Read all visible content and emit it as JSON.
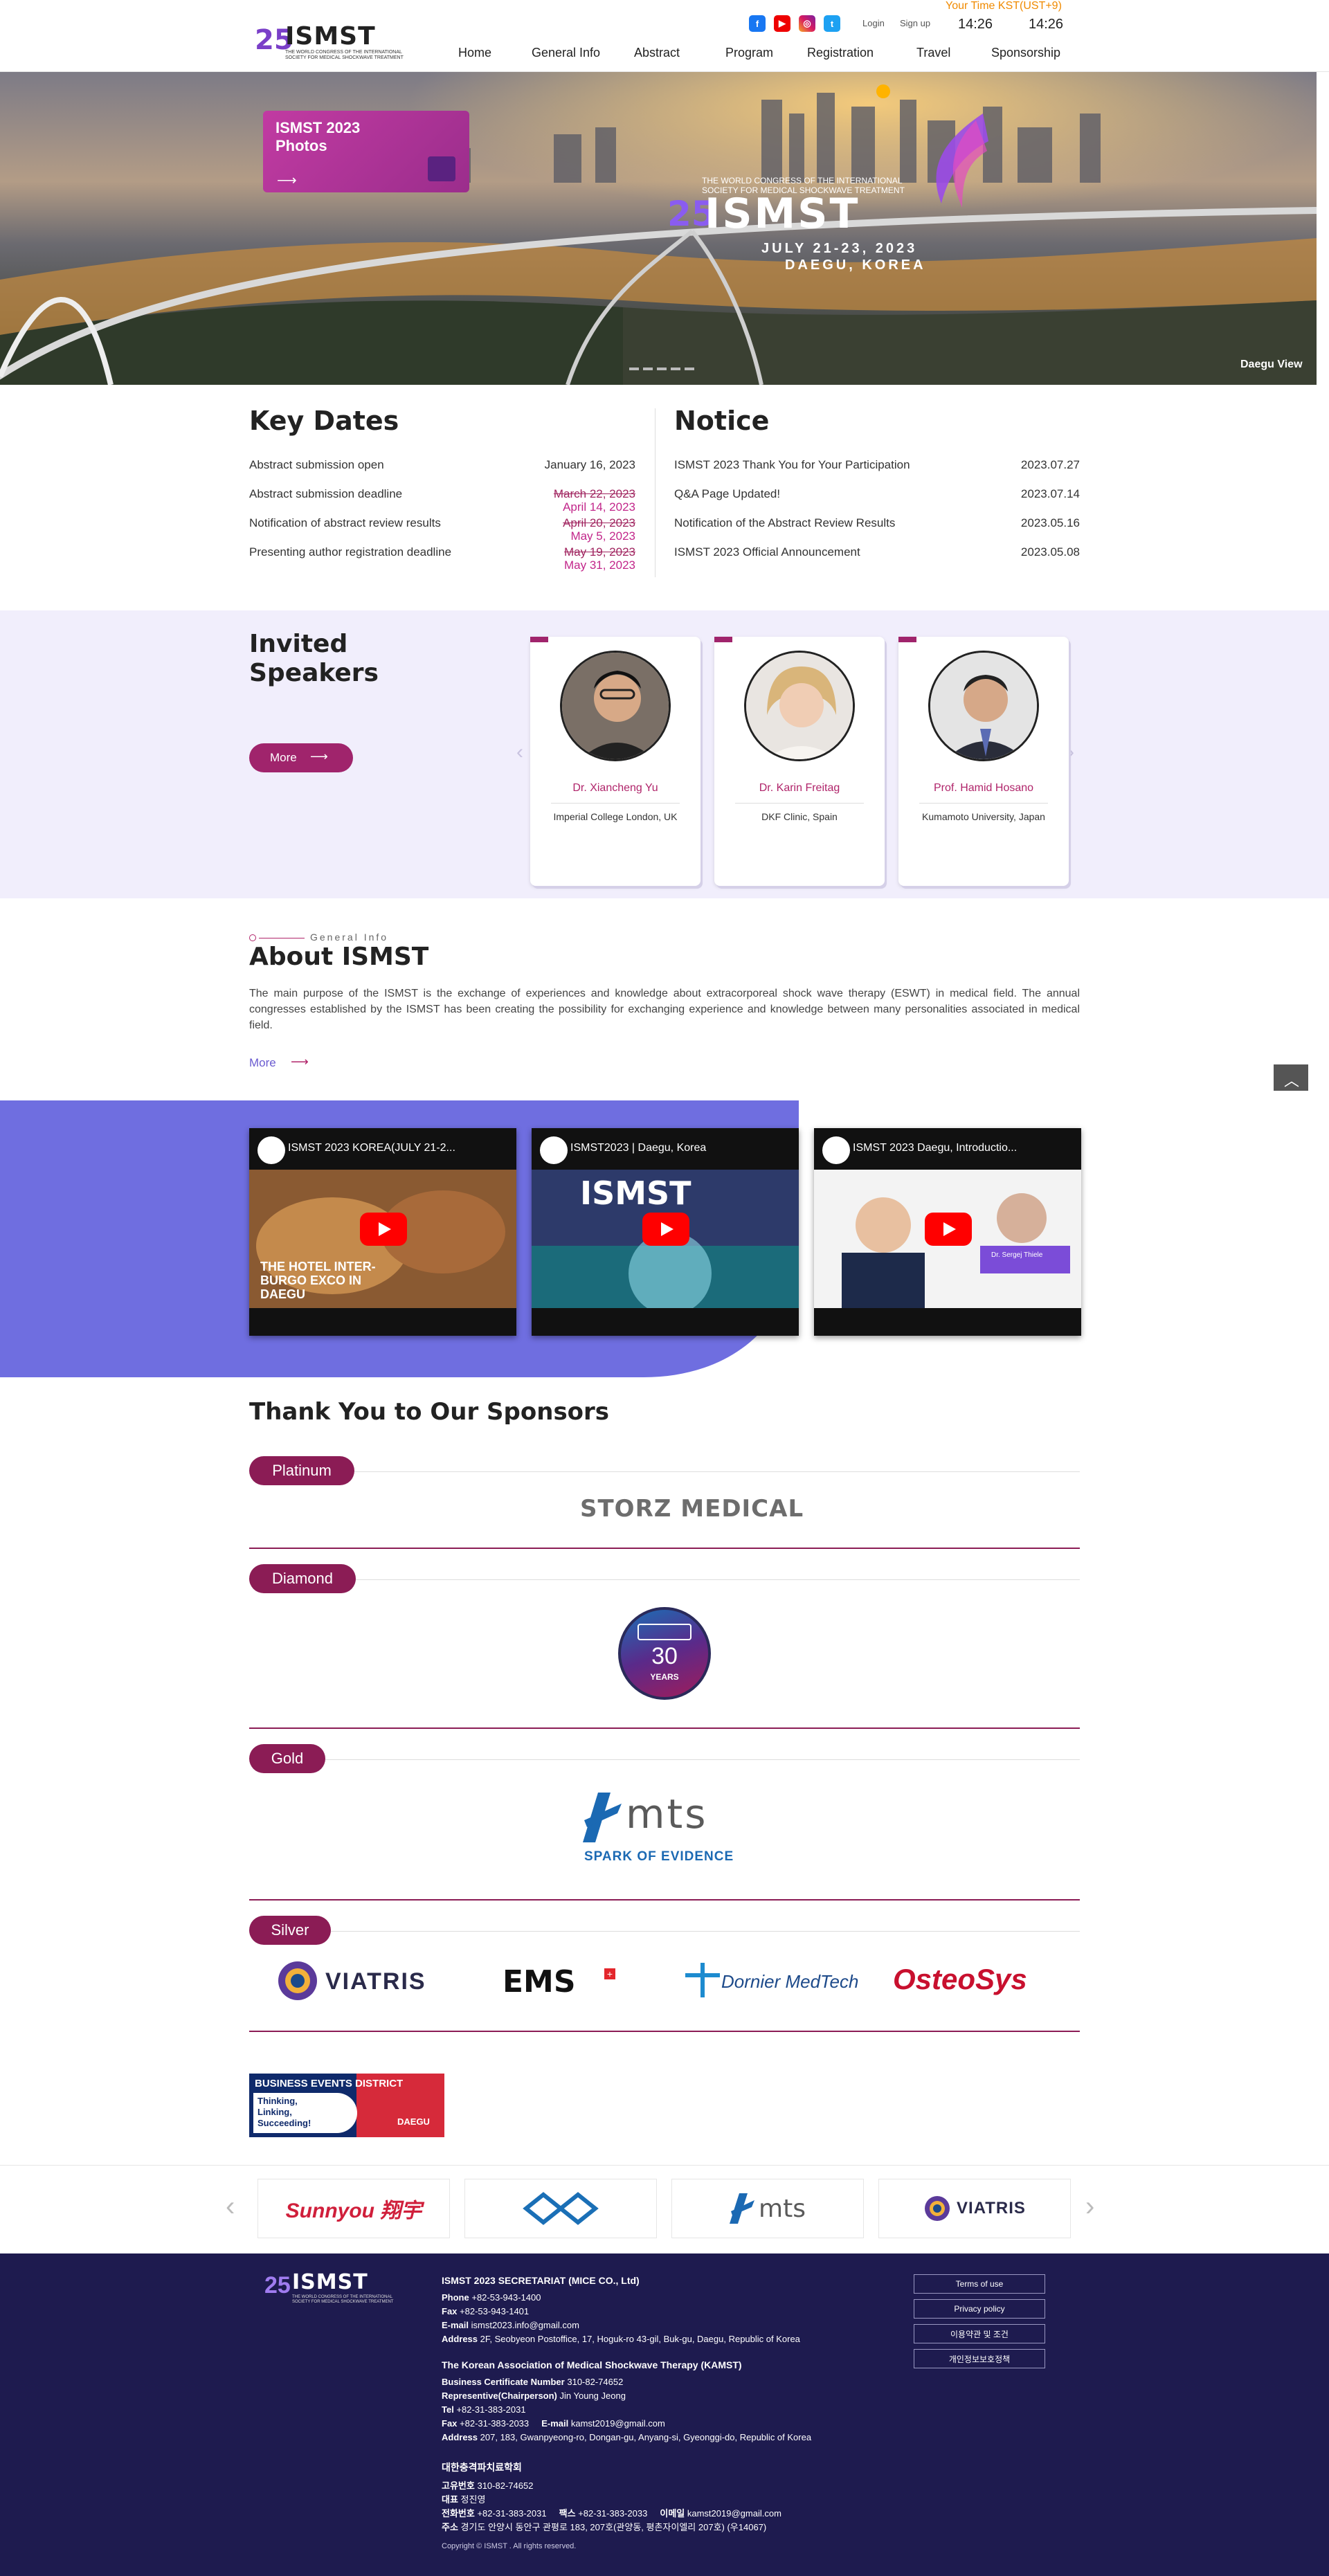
{
  "header": {
    "logo": {
      "word": "ISMST",
      "number": "25",
      "line1": "THE WORLD CONGRESS OF THE INTERNATIONAL",
      "line2": "SOCIETY FOR MEDICAL SHOCKWAVE TREATMENT"
    },
    "time_label": "Your Time  KST(UST+9)",
    "time1": "14:26",
    "time2": "14:26",
    "login": "Login",
    "signup": "Sign up",
    "nav": [
      "Home",
      "General Info",
      "Abstract",
      "Program",
      "Registration",
      "Travel",
      "Sponsorship"
    ]
  },
  "hero": {
    "photo_card": "ISMST 2023 Photos",
    "brand_line1": "THE WORLD CONGRESS OF THE INTERNATIONAL",
    "brand_line2": "SOCIETY FOR MEDICAL SHOCKWAVE TREATMENT",
    "brand_word": "ISMST",
    "brand_num": "25",
    "dates": "JULY 21-23, 2023",
    "city": "DAEGU, KOREA",
    "caption": "Daegu View"
  },
  "key_dates": {
    "title": "Key Dates",
    "rows": [
      {
        "label": "Abstract submission open",
        "date": "January 16, 2023",
        "old": "",
        "new": ""
      },
      {
        "label": "Abstract submission deadline",
        "date": "",
        "old": "March 22, 2023",
        "new": "April 14, 2023"
      },
      {
        "label": "Notification of abstract review results",
        "date": "",
        "old": "April 20, 2023",
        "new": "May 5, 2023"
      },
      {
        "label": "Presenting author registration deadline",
        "date": "",
        "old": "May 19, 2023",
        "new": "May 31, 2023"
      }
    ]
  },
  "notice": {
    "title": "Notice",
    "rows": [
      {
        "label": "ISMST 2023 Thank You for Your Participation",
        "date": "2023.07.27"
      },
      {
        "label": "Q&A Page Updated!",
        "date": "2023.07.14"
      },
      {
        "label": "Notification of the Abstract Review Results",
        "date": "2023.05.16"
      },
      {
        "label": "ISMST 2023 Official Announcement",
        "date": "2023.05.08"
      }
    ]
  },
  "speakers": {
    "title1": "Invited",
    "title2": "Speakers",
    "more": "More",
    "cards": [
      {
        "name": "Dr. Xiancheng Yu",
        "aff": "Imperial College London, UK"
      },
      {
        "name": "Dr. Karin Freitag",
        "aff": "DKF Clinic, Spain"
      },
      {
        "name": "Prof. Hamid Hosano",
        "aff": "Kumamoto University, Japan"
      }
    ]
  },
  "about": {
    "eyebrow": "General Info",
    "title": "About ISMST",
    "text": "The main purpose of the ISMST is the exchange of experiences and knowledge about extracorporeal shock wave therapy (ESWT) in medical field. The annual congresses established by the ISMST has been creating the possibility for exchanging experience and knowledge between many personalities associated in medical field.",
    "more": "More"
  },
  "videos": [
    {
      "title": "ISMST 2023 KOREA(JULY 21-2...",
      "overlay": "THE HOTEL INTER-BURGO EXCO IN DAEGU"
    },
    {
      "title": "ISMST2023 | Daegu, Korea",
      "overlay": ""
    },
    {
      "title": "ISMST 2023 Daegu, Introductio...",
      "overlay": "Dr. Sergej Thiele"
    }
  ],
  "sponsors": {
    "title": "Thank You to Our Sponsors",
    "tiers": {
      "platinum": "Platinum",
      "diamond": "Diamond",
      "gold": "Gold",
      "silver": "Silver"
    },
    "storz": "STORZ MEDICAL",
    "diamond_years": "30",
    "diamond_word": "YEARS",
    "mts_word": "mts",
    "mts_tag": "SPARK OF EVIDENCE",
    "silver": [
      "VIATRIS",
      "EMS",
      "Dornier MedTech",
      "OsteoSys"
    ],
    "bed": {
      "l1": "BUSINESS EVENTS DISTRICT",
      "l2": "Thinking,",
      "l3": "Linking,",
      "l4": "Succeeding!",
      "l5": "DAEGU"
    }
  },
  "slider": {
    "logos": [
      "Sunnyou 翔宇",
      "",
      "mts",
      "VIATRIS"
    ]
  },
  "footer": {
    "sec_title": "ISMST 2023 SECRETARIAT (MICE CO., Ltd)",
    "phone_l": "Phone",
    "phone": "+82-53-943-1400",
    "fax_l": "Fax",
    "fax": "+82-53-943-1401",
    "email_l": "E-mail",
    "email": "ismst2023.info@gmail.com",
    "addr_l": "Address",
    "addr": "2F, Seobyeon Postoffice, 17, Hoguk-ro 43-gil, Buk-gu, Daegu, Republic of Korea",
    "kamst_title": "The Korean Association of Medical Shockwave Therapy (KAMST)",
    "bcn_l": "Business Certificate Number",
    "bcn": "310-82-74652",
    "rep_l": "Representive(Chairperson)",
    "rep": "Jin Young Jeong",
    "tel_l": "Tel",
    "tel": "+82-31-383-2031",
    "kfax_l": "Fax",
    "kfax": "+82-31-383-2033",
    "kmail_l": "E-mail",
    "kmail": "kamst2019@gmail.com",
    "kaddr_l": "Address",
    "kaddr": "207, 183, Gwanpyeong-ro, Dongan-gu, Anyang-si, Gyeonggi-do, Republic of Korea",
    "kr_title": "대한충격파치료학회",
    "kr1_l": "고유번호",
    "kr1": "310-82-74652",
    "kr2_l": "대표",
    "kr2": "정진영",
    "kr3_l": "전화번호",
    "kr3": "+82-31-383-2031",
    "kr3b_l": "팩스",
    "kr3b": "+82-31-383-2033",
    "kr3c_l": "이메일",
    "kr3c": "kamst2019@gmail.com",
    "kr4_l": "주소",
    "kr4": "경기도 안양시 동안구 관평로 183, 207호(관양동, 평촌자이엘리 207호) (우14067)",
    "copy": "Copyright © ISMST . All rights reserved.",
    "buttons": [
      "Terms of use",
      "Privacy policy",
      "이용약관 및 조건",
      "개인정보보호정책"
    ]
  }
}
